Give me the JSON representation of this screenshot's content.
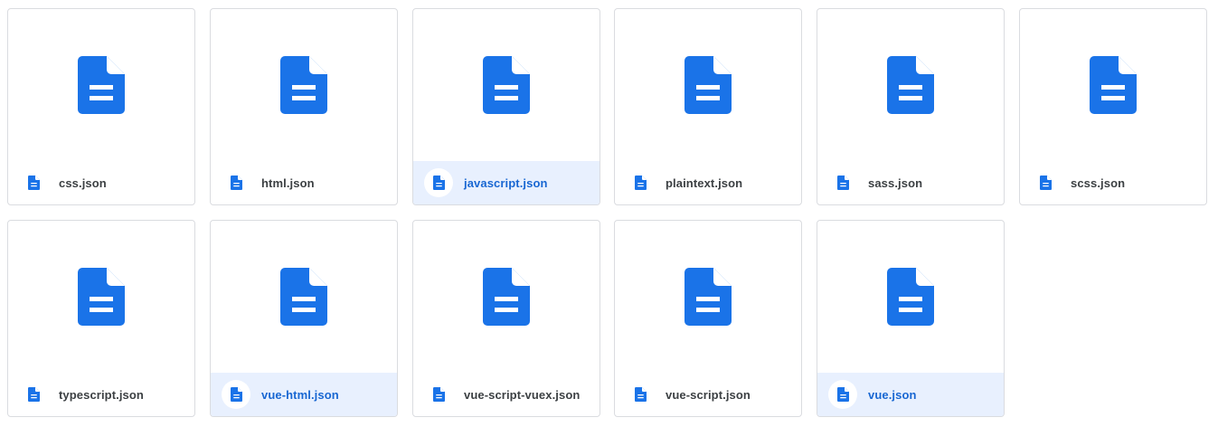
{
  "accent_color": "#1a73e8",
  "selected_bg": "#e8f0fe",
  "selected_text_color": "#1967d2",
  "file_icon": "document-icon",
  "files": [
    {
      "name": "css.json",
      "selected": false
    },
    {
      "name": "html.json",
      "selected": false
    },
    {
      "name": "javascript.json",
      "selected": true
    },
    {
      "name": "plaintext.json",
      "selected": false
    },
    {
      "name": "sass.json",
      "selected": false
    },
    {
      "name": "scss.json",
      "selected": false
    },
    {
      "name": "typescript.json",
      "selected": false
    },
    {
      "name": "vue-html.json",
      "selected": true
    },
    {
      "name": "vue-script-vuex.json",
      "selected": false
    },
    {
      "name": "vue-script.json",
      "selected": false
    },
    {
      "name": "vue.json",
      "selected": true
    }
  ]
}
